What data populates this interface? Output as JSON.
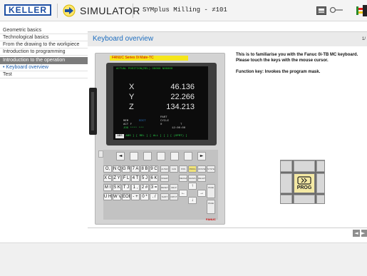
{
  "header": {
    "logo_text": "KELLER",
    "app_title": "SIMULATOR",
    "document_title": "SYMplus Milling - ≠101",
    "icons": [
      "arrow-right-icon",
      "print-icon",
      "search-icon",
      "exit-icon"
    ]
  },
  "nav": {
    "items": [
      {
        "label": "Geometric basics"
      },
      {
        "label": "Technological basics"
      },
      {
        "label": "From the drawing to the workpiece"
      },
      {
        "label": "Introduction to programming"
      },
      {
        "label": "Introduction to the operation"
      },
      {
        "label": "• Keyboard overview"
      },
      {
        "label": "Test"
      }
    ]
  },
  "content": {
    "title": "Keyboard overview",
    "page_number": "1/",
    "description_1": "This is to familiarise you with the Fanuc 0i-TB MC keyboard. Please touch the keys with the mouse cursor.",
    "description_2": "Function key: Invokes the program mask."
  },
  "control": {
    "label": "FANUC Series 0i Mate-TC",
    "screen": {
      "heading": "ACTUAL POSITION(REL)     O0000   N00000",
      "axes": [
        {
          "name": "X",
          "value": "46.136"
        },
        {
          "name": "Y",
          "value": "22.266"
        },
        {
          "name": "Z",
          "value": "134.213"
        }
      ],
      "part_label": "PART",
      "cycle_label": "CYCLE",
      "edit_label": "EDIT",
      "mode": "MEM",
      "actf": "ACT F",
      "actf_value": "0",
      "t_label": "T",
      "status": "JOG **** ***",
      "clock": "12:00:00",
      "softkeys": "ABS ] [ REL ] [ ALL ] [   ] [ (OPRT) ]",
      "abs_label": "ABS"
    },
    "keys": {
      "row1": [
        "O,",
        "N Q",
        "G R",
        "7 A",
        "8 B",
        "9 C"
      ],
      "row2": [
        "X C",
        "Z Y",
        "F L",
        "4 T",
        "5 J",
        "6 K"
      ],
      "row3": [
        "M I",
        "S K",
        "T J",
        "1 ,",
        "2 #",
        "3 ="
      ],
      "row4": [
        "U H",
        "W V",
        "EOB",
        "- +",
        "0 *",
        ". /"
      ],
      "func_labels": [
        "ALTER",
        "CAN",
        "POS",
        "PROG",
        "OFS/SET",
        "SYSTEM",
        "MESSAGE",
        "GRAPH",
        "INSERT",
        "DELETE",
        "SHIFT",
        "INPUT",
        "HELP",
        "RESET",
        "PAGE",
        "PAGE"
      ],
      "arrows": [
        "◄",
        "►",
        "↑",
        "↓",
        "←",
        "→"
      ]
    },
    "brand": "FANUC"
  },
  "zoom": {
    "key_label": "PROG"
  },
  "pager": {
    "prev": "◄",
    "next": "►"
  }
}
